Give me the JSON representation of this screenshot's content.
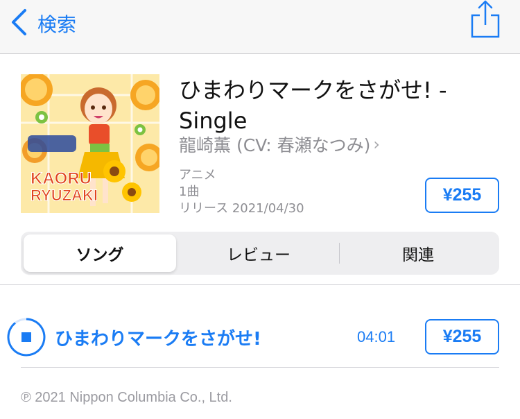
{
  "nav": {
    "back_label": "検索",
    "back_icon": "chevron-left-icon",
    "share_icon": "share-icon"
  },
  "album": {
    "title": "ひまわりマークをさがせ! - Single",
    "artist": "龍崎薫 (CV: 春瀬なつみ)",
    "artist_chevron": "›",
    "genre": "アニメ",
    "track_count": "1曲",
    "release": "リリース 2021/04/30",
    "price": "¥255",
    "artwork_text": [
      "KAORU",
      "RYUZAKI"
    ]
  },
  "segments": {
    "items": [
      "ソング",
      "レビュー",
      "関連"
    ],
    "selected": "ソング"
  },
  "tracks": [
    {
      "title": "ひまわりマークをさがせ!",
      "duration": "04:01",
      "price": "¥255"
    }
  ],
  "footer": {
    "copyright": "℗ 2021 Nippon Columbia Co., Ltd."
  },
  "colors": {
    "accent": "#1a7cf4",
    "secondary_text": "#8e8e93",
    "nav_background": "#f7f7f7"
  }
}
